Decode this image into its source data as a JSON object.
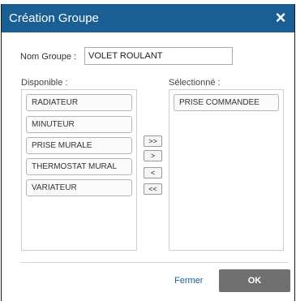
{
  "dialog": {
    "title": "Création Groupe",
    "close_icon": "×"
  },
  "name": {
    "label": "Nom Groupe :",
    "value": "VOLET ROULANT"
  },
  "available": {
    "label": "Disponible :",
    "items": [
      "RADIATEUR",
      "MINUTEUR",
      "PRISE MURALE",
      "THERMOSTAT MURAL",
      "VARIATEUR"
    ]
  },
  "selected": {
    "label": "Sélectionné :",
    "items": [
      "PRISE COMMANDEE"
    ]
  },
  "move_buttons": {
    "add_all": ">>",
    "add": ">",
    "remove": "<",
    "remove_all": "<<"
  },
  "footer": {
    "close_label": "Fermer",
    "ok_label": "OK"
  },
  "colors": {
    "titlebar": "#1a5f94",
    "ok_button": "#707070"
  }
}
